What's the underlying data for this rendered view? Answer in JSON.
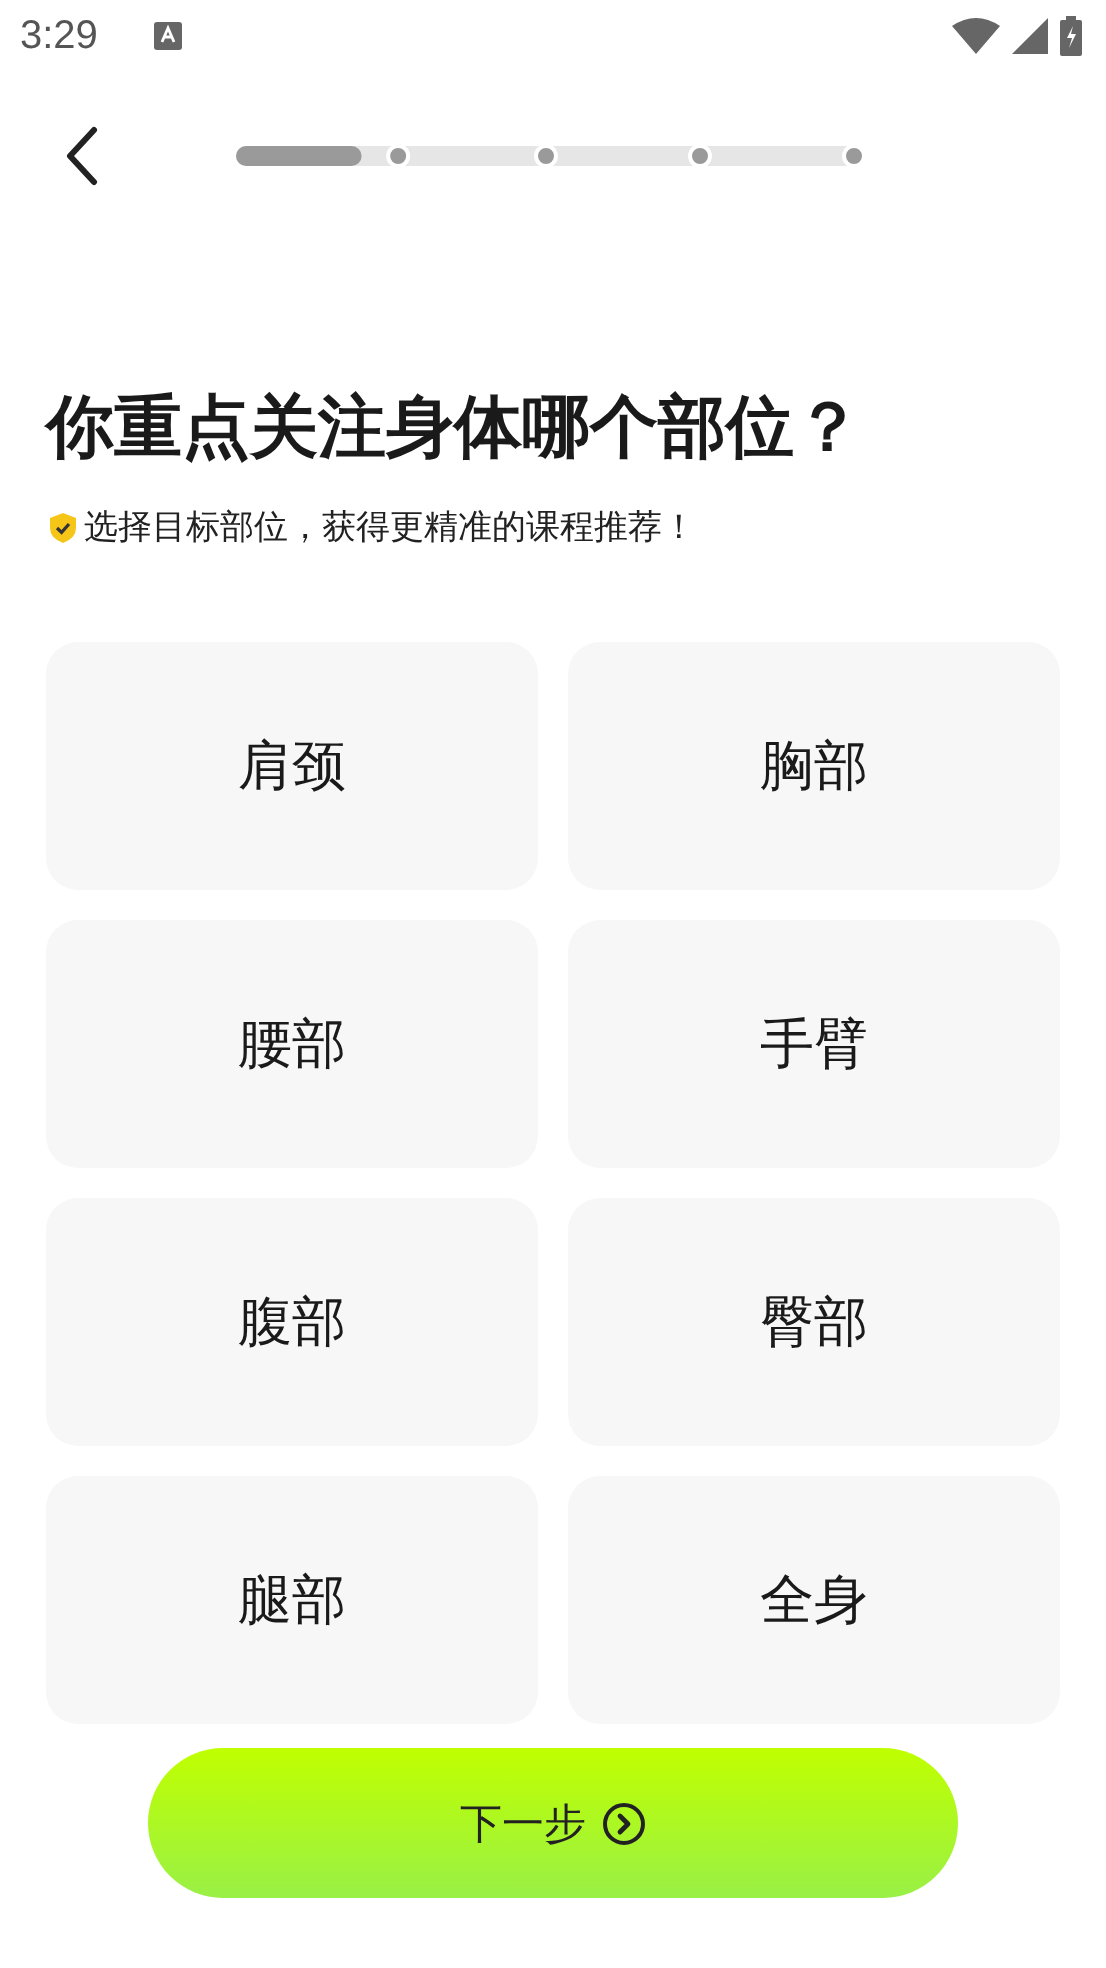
{
  "status_bar": {
    "time": "3:29"
  },
  "progress": {
    "level": 0.2
  },
  "title": "你重点关注身体哪个部位？",
  "subtitle": "选择目标部位，获得更精准的课程推荐！",
  "options": [
    {
      "label": "肩颈",
      "selected": false
    },
    {
      "label": "胸部",
      "selected": false
    },
    {
      "label": "腰部",
      "selected": false
    },
    {
      "label": "手臂",
      "selected": false
    },
    {
      "label": "腹部",
      "selected": false
    },
    {
      "label": "臀部",
      "selected": false
    },
    {
      "label": "腿部",
      "selected": false
    },
    {
      "label": "全身",
      "selected": false
    }
  ],
  "next_button": "下一步"
}
